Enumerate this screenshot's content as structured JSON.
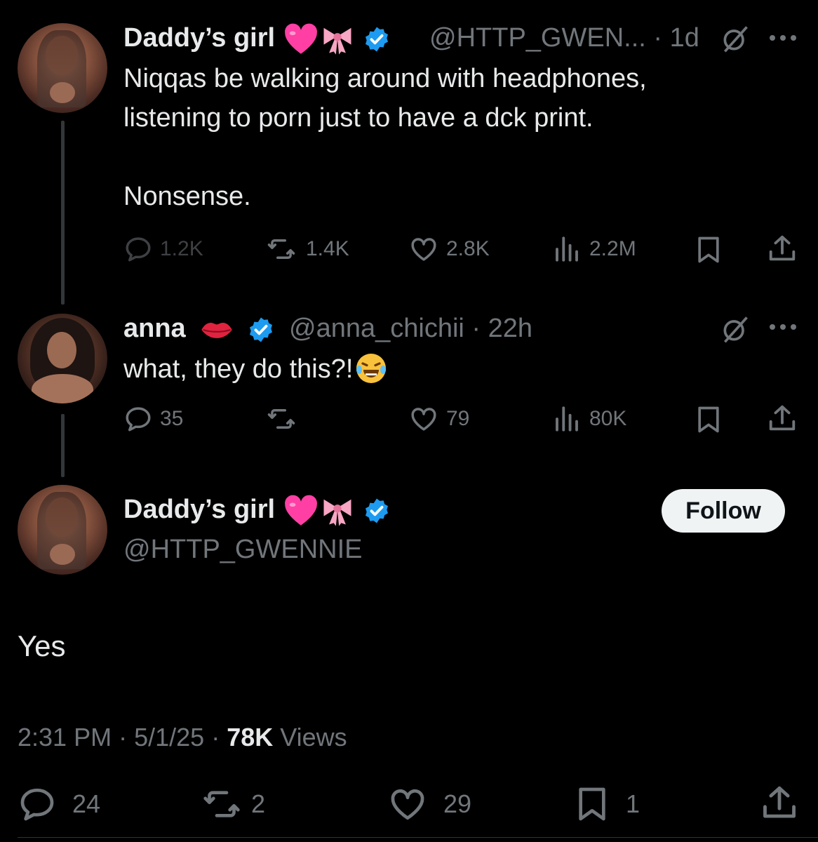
{
  "tweets": [
    {
      "display_name": "Daddy’s girl",
      "handle": "@HTTP_GWEN...",
      "time": "1d",
      "lines": [
        "Niqqas be walking around with headphones,",
        "listening to porn just to have a dck print.",
        "",
        "Nonsense."
      ],
      "stats": {
        "replies": "1.2K",
        "reposts": "1.4K",
        "likes": "2.8K",
        "views": "2.2M"
      }
    },
    {
      "display_name": "anna",
      "handle": "@anna_chichii",
      "time": "22h",
      "text": "what, they do this?!",
      "stats": {
        "replies": "35",
        "reposts": "",
        "likes": "79",
        "views": "80K"
      }
    }
  ],
  "main": {
    "display_name": "Daddy’s girl",
    "handle": "@HTTP_GWENNIE",
    "follow_label": "Follow",
    "text": "Yes",
    "time": "2:31 PM",
    "date": "5/1/25",
    "views_count": "78K",
    "views_label": "Views",
    "stats": {
      "replies": "24",
      "reposts": "2",
      "likes": "29",
      "bookmarks": "1"
    }
  },
  "separator": "·",
  "icons": [
    "heart-emoji-icon",
    "bow-emoji-icon",
    "verified-badge-icon",
    "grok-icon",
    "more-icon",
    "reply-icon",
    "repost-icon",
    "like-icon",
    "views-icon",
    "bookmark-icon",
    "share-icon",
    "kiss-mark-emoji-icon",
    "laughing-emoji-icon"
  ],
  "colors": {
    "background": "#000000",
    "text": "#e7e9ea",
    "muted": "#71767b",
    "verified": "#1d9bf0",
    "heart_emoji": "#ff3fa4",
    "bow_emoji": "#f7a6c4"
  }
}
